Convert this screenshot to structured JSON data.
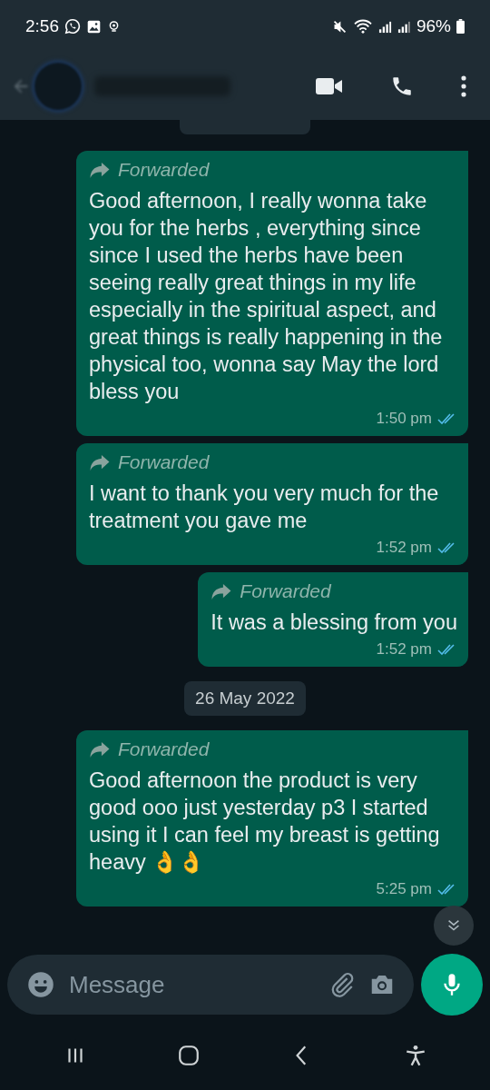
{
  "status_bar": {
    "time": "2:56",
    "battery": "96%"
  },
  "messages": [
    {
      "kind": "message",
      "forwarded_label": "Forwarded",
      "text": "Good afternoon, I really wonna take you for the herbs , everything since since I used the herbs have been seeing really great things in my life especially in the spiritual aspect, and great things is really happening in the physical too, wonna say May the lord bless you",
      "time": "1:50 pm",
      "read": true
    },
    {
      "kind": "message",
      "forwarded_label": "Forwarded",
      "text": "I want to thank you very much for the treatment you gave me",
      "time": "1:52 pm",
      "read": true
    },
    {
      "kind": "message",
      "forwarded_label": "Forwarded",
      "text": "It was a blessing from you",
      "time": "1:52 pm",
      "read": true
    },
    {
      "kind": "date",
      "text": "26 May 2022"
    },
    {
      "kind": "message",
      "forwarded_label": "Forwarded",
      "text": "Good afternoon the product is very good ooo just yesterday p3 I started using it I can feel my breast is getting heavy 👌👌",
      "time": "5:25 pm",
      "read": true
    }
  ],
  "composer": {
    "placeholder": "Message"
  }
}
